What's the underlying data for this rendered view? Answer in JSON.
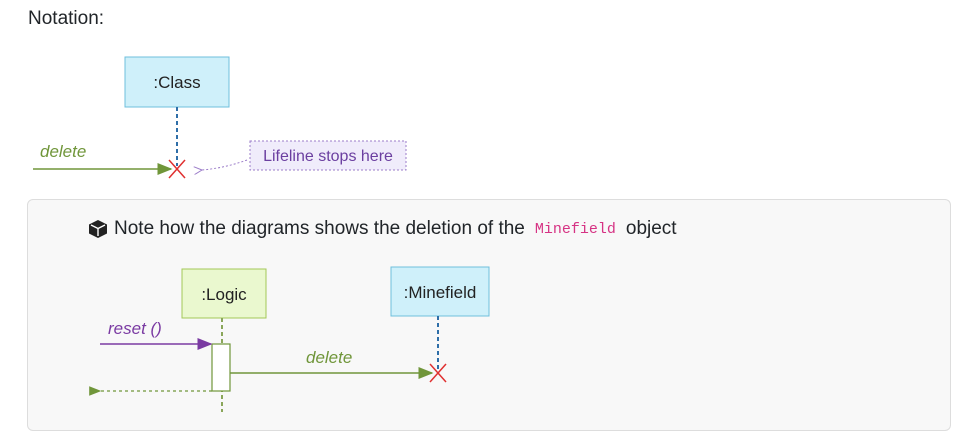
{
  "heading": "Notation:",
  "notation": {
    "class_box": ":Class",
    "message": "delete",
    "callout": "Lifeline stops here"
  },
  "example": {
    "note_prefix": "Note how the diagrams shows the deletion of the",
    "note_code": "Minefield",
    "note_suffix": "object",
    "logic_box": ":Logic",
    "minefield_box": ":Minefield",
    "reset_label": "reset ()",
    "delete_label": "delete"
  },
  "colors": {
    "class_fill": "#cff0fa",
    "class_stroke": "#6fbfdc",
    "logic_fill": "#eaf8cf",
    "logic_stroke": "#a3c857",
    "message_green": "#70963a",
    "reset_purple": "#7a3aa2",
    "callout_fill": "#f0ecfb",
    "callout_stroke": "#9b7cc9",
    "lifeline_blue": "#2e6ea8",
    "x_red": "#e03030",
    "code_pink": "#d63384"
  }
}
